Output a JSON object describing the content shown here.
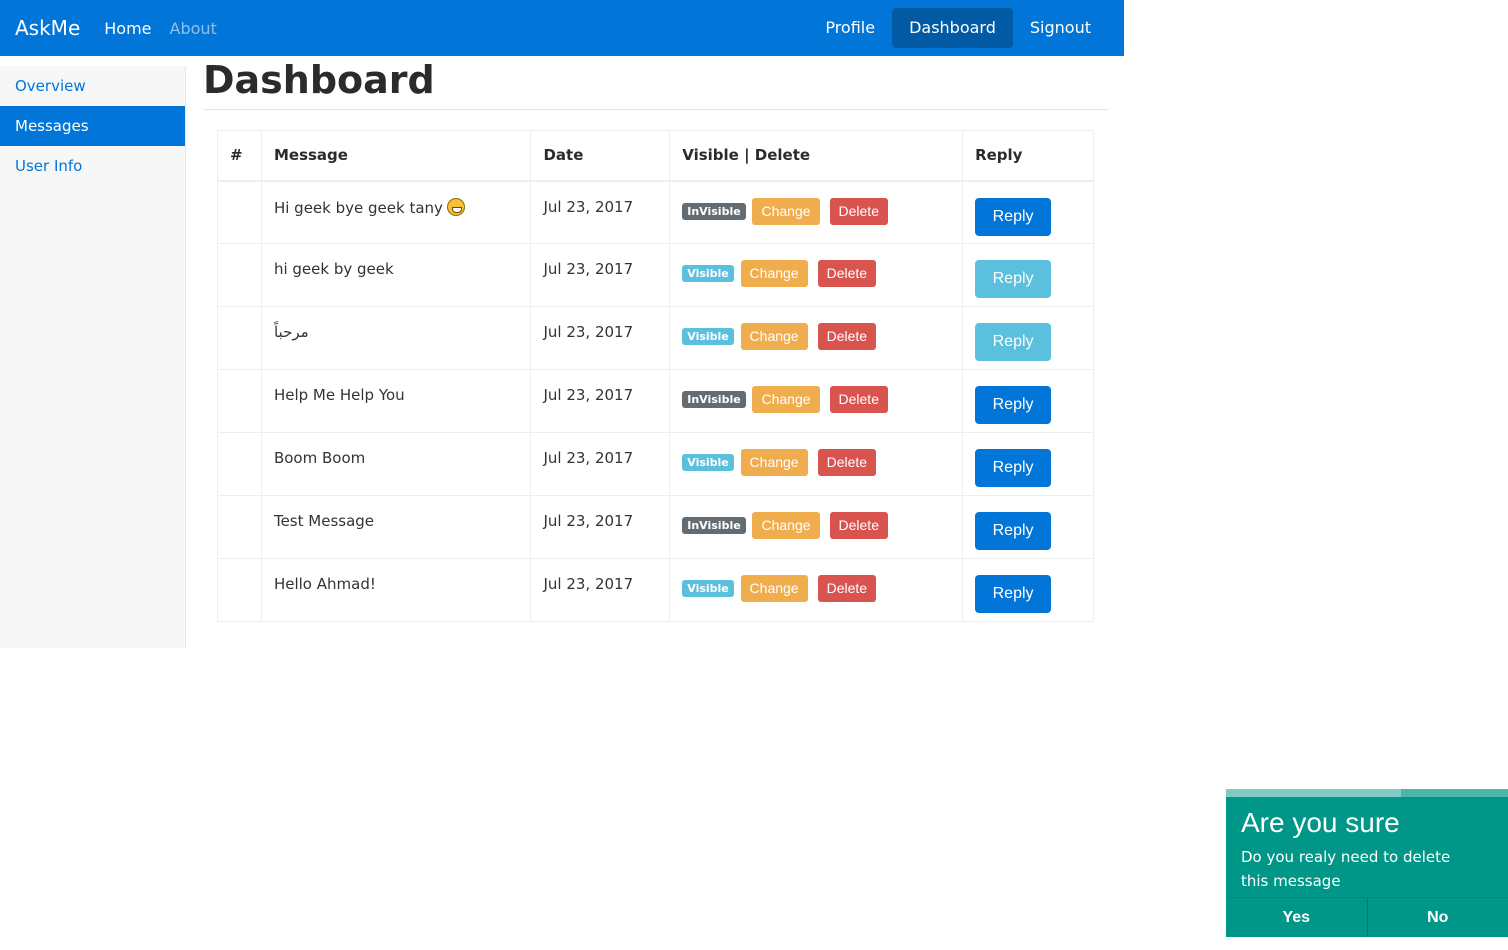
{
  "navbar": {
    "brand": "AskMe",
    "left_links": [
      {
        "label": "Home",
        "muted": false
      },
      {
        "label": "About",
        "muted": true
      }
    ],
    "right_links": [
      {
        "label": "Profile",
        "active": false
      },
      {
        "label": "Dashboard",
        "active": true
      },
      {
        "label": "Signout",
        "active": false
      }
    ],
    "color": "#0275d8"
  },
  "sidebar": {
    "items": [
      {
        "label": "Overview",
        "active": false
      },
      {
        "label": "Messages",
        "active": true
      },
      {
        "label": "User Info",
        "active": false
      }
    ]
  },
  "page": {
    "title": "Dashboard"
  },
  "table": {
    "headers": [
      "#",
      "Message",
      "Date",
      "Visible | Delete",
      "Reply"
    ],
    "change_label": "Change",
    "delete_label": "Delete",
    "reply_label": "Reply",
    "rows": [
      {
        "num": "",
        "message": "Hi geek bye geek tany",
        "emoji": "grinning-face-icon",
        "date": "Jul 23, 2017",
        "visibility": "InVisible",
        "reply_style": "primary"
      },
      {
        "num": "",
        "message": "hi geek by geek",
        "date": "Jul 23, 2017",
        "visibility": "Visible",
        "reply_style": "info"
      },
      {
        "num": "",
        "message": "مرحباً",
        "date": "Jul 23, 2017",
        "visibility": "Visible",
        "reply_style": "info"
      },
      {
        "num": "",
        "message": "Help Me Help You",
        "date": "Jul 23, 2017",
        "visibility": "InVisible",
        "reply_style": "primary"
      },
      {
        "num": "",
        "message": "Boom Boom",
        "date": "Jul 23, 2017",
        "visibility": "Visible",
        "reply_style": "primary"
      },
      {
        "num": "",
        "message": "Test Message",
        "date": "Jul 23, 2017",
        "visibility": "InVisible",
        "reply_style": "primary"
      },
      {
        "num": "",
        "message": "Hello Ahmad!",
        "date": "Jul 23, 2017",
        "visibility": "Visible",
        "reply_style": "primary"
      }
    ]
  },
  "toast": {
    "title": "Are you sure",
    "body": "Do you realy need to delete this message",
    "yes_label": "Yes",
    "no_label": "No",
    "progress": 0.62,
    "color": "#009688"
  }
}
